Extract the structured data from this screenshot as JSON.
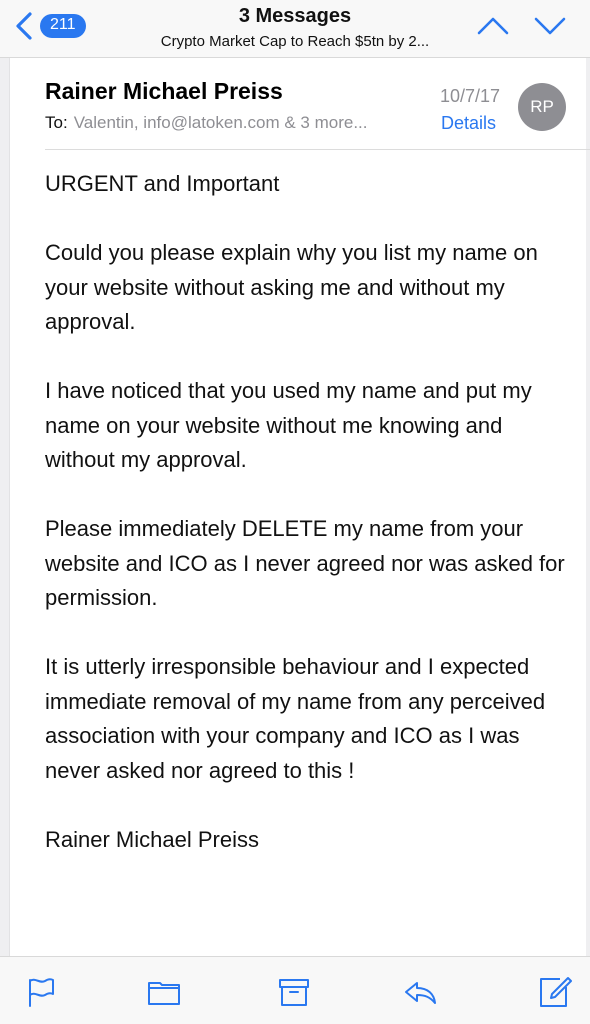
{
  "header": {
    "back_badge": "211",
    "title": "3 Messages",
    "subtitle": "Crypto Market Cap to Reach $5tn by 2..."
  },
  "message": {
    "sender": "Rainer Michael Preiss",
    "to_label": "To:",
    "recipients": "Valentin, info@latoken.com & 3 more...",
    "date": "10/7/17",
    "details": "Details",
    "avatar_initials": "RP",
    "paragraphs": [
      "URGENT and Important",
      "Could you please explain why you list my name on your website without asking me and without my approval.",
      "I have noticed that you used my name and put my name on your website without me knowing and without my approval.",
      "Please immediately DELETE my name from your website and ICO as I never agreed nor was asked for permission.",
      "It is utterly irresponsible behaviour and I expected immediate removal of my name from any perceived association with your company and ICO as I was never asked nor agreed to this !"
    ],
    "signature": "Rainer Michael Preiss"
  },
  "toolbar": {
    "icons": [
      "flag-icon",
      "folder-icon",
      "archive-icon",
      "reply-icon",
      "compose-icon"
    ]
  },
  "colors": {
    "accent": "#2a78f0",
    "secondary_text": "#8e8e93",
    "bar_background": "#f8f8f8"
  }
}
